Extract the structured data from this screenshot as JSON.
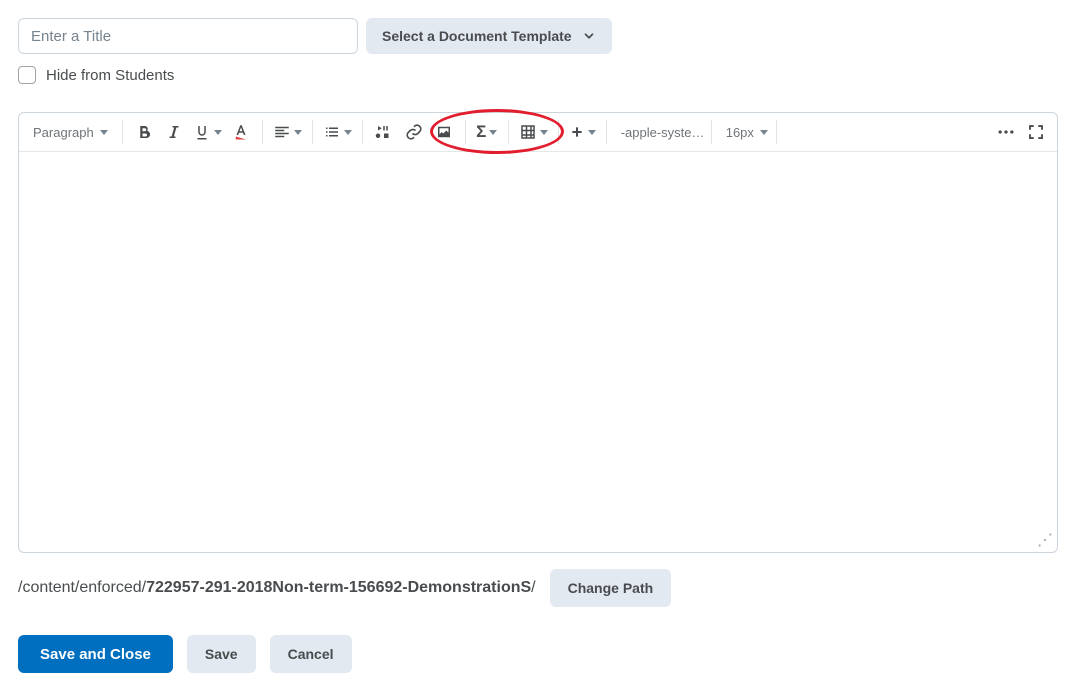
{
  "topbar": {
    "title_placeholder": "Enter a Title",
    "template_button": "Select a Document Template",
    "hide_label": "Hide from Students"
  },
  "toolbar": {
    "paragraph": "Paragraph",
    "font": "-apple-syste…",
    "size": "16px"
  },
  "path": {
    "prefix": "/content/enforced/",
    "bold": "722957-291-2018Non-term-156692-DemonstrationS",
    "suffix": "/",
    "change_button": "Change Path"
  },
  "footer": {
    "save_close": "Save and Close",
    "save": "Save",
    "cancel": "Cancel"
  }
}
